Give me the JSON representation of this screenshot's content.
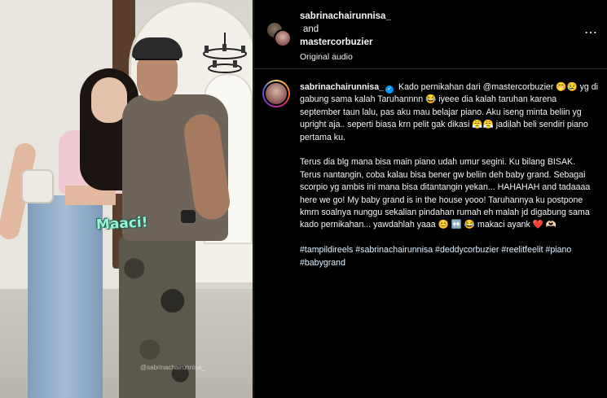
{
  "photo": {
    "sticker_text": "Maaci!",
    "watermark": "@sabrinachairunnisa_"
  },
  "header": {
    "user1": "sabrinachairunnisa_",
    "and": "and",
    "user2": "mastercorbuzier",
    "audio": "Original audio",
    "more_icon": "⋯"
  },
  "caption": {
    "username": "sabrinachairunnisa_",
    "verified_icon": "✓",
    "p1": "Kado pernikahan dari @mastercorbuzier 🤭😢 yg di gabung sama kalah Taruhannnn 😂 iyeee dia kalah taruhan karena september taun lalu, pas aku mau belajar piano. Aku iseng minta beliin yg upright aja.. seperti biasa krn pelit gak dikasi 😤😤 jadilah beli sendiri piano pertama ku.",
    "p2": "Terus dia blg mana bisa main piano udah umur segini. Ku bilang BISAK. Terus nantangin, coba kalau bisa bener gw beliin deh baby grand. Sebagai scorpio yg ambis ini mana bisa ditantangin yekan... HAHAHAH and tadaaaa here we go! My baby grand is in the house yooo! Taruhannya ku postpone kmrn soalnya nunggu sekalian pindahan rumah eh malah jd digabung sama kado pernikahan... yawdahlah yaaa 😊 ↔️ 😂 makaci ayank ❤️ 🫶🏻",
    "tags": "#tampildireels #sabrinachairunnisa #deddycorbuzier #reelitfeelit #piano #babygrand"
  }
}
